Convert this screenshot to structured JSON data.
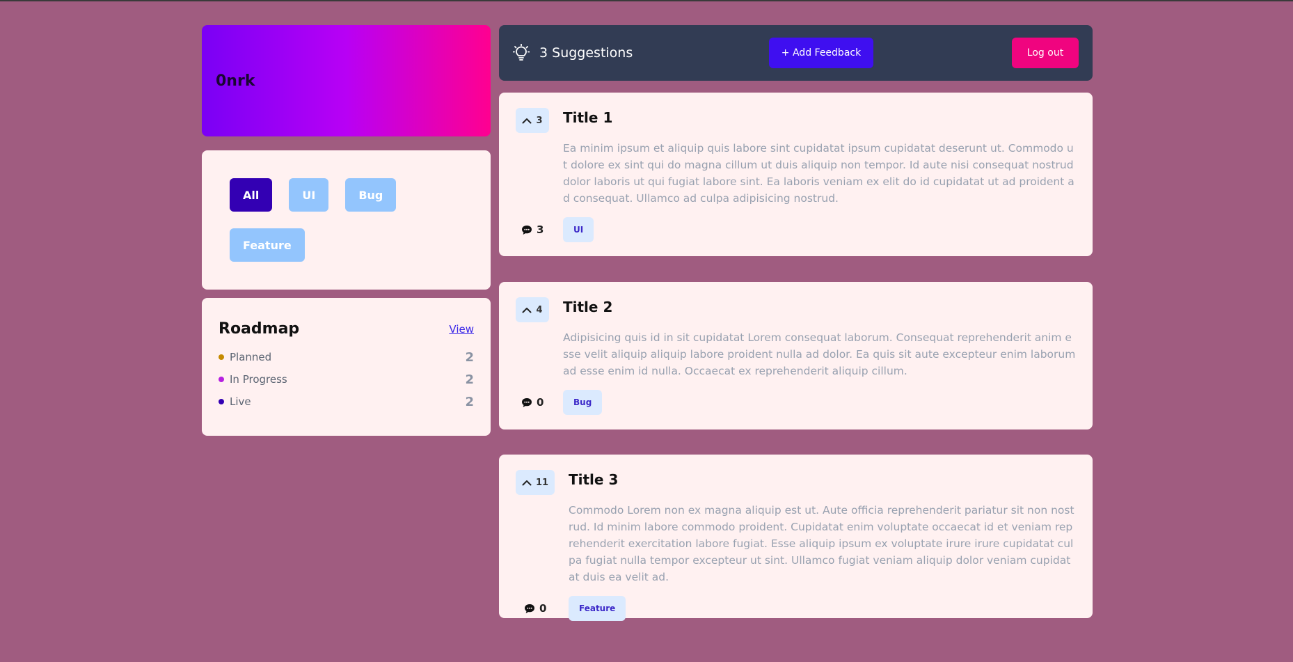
{
  "brand": {
    "name": "0nrk"
  },
  "filters": {
    "chips": [
      {
        "label": "All",
        "active": true
      },
      {
        "label": "UI",
        "active": false
      },
      {
        "label": "Bug",
        "active": false
      },
      {
        "label": "Feature",
        "active": false
      }
    ]
  },
  "roadmap": {
    "title": "Roadmap",
    "view_label": "View",
    "items": [
      {
        "label": "Planned",
        "count": "2",
        "color": "#c58a00"
      },
      {
        "label": "In Progress",
        "count": "2",
        "color": "#b620e0"
      },
      {
        "label": "Live",
        "count": "2",
        "color": "#3300b3"
      }
    ]
  },
  "topbar": {
    "suggestions_label": "3 Suggestions",
    "icon": "lightbulb-icon",
    "add_button_label": "+ Add Feedback",
    "logout_label": "Log out"
  },
  "feedback": [
    {
      "title": "Title 1",
      "upvotes": "3",
      "description": "Ea minim ipsum et aliquip quis labore sint cupidatat ipsum cupidatat deserunt ut. Commodo ut dolore ex sint qui do magna cillum ut duis aliquip non tempor. Id aute nisi consequat nostrud dolor laboris ut qui fugiat labore sint. Ea laboris veniam ex elit do id cupidatat ut ad proident ad consequat. Ullamco ad culpa adipisicing nostrud.",
      "comments": "3",
      "tag": "UI"
    },
    {
      "title": "Title 2",
      "upvotes": "4",
      "description": "Adipisicing quis id in sit cupidatat Lorem consequat laborum. Consequat reprehenderit anim esse velit aliquip aliquip labore proident nulla ad dolor. Ea quis sit aute excepteur enim laborum ad esse enim id nulla. Occaecat ex reprehenderit aliquip cillum.",
      "comments": "0",
      "tag": "Bug"
    },
    {
      "title": "Title 3",
      "upvotes": "11",
      "description": "Commodo Lorem non ex magna aliquip est ut. Aute officia reprehenderit pariatur sit non nostrud. Id minim labore commodo proident. Cupidatat enim voluptate occaecat id et veniam reprehenderit exercitation labore fugiat. Esse aliquip ipsum ex voluptate irure irure cupidatat culpa fugiat nulla tempor excepteur ut sint. Ullamco fugiat veniam aliquip dolor veniam cupidatat duis ea velit ad.",
      "comments": "0",
      "tag": "Feature"
    }
  ],
  "colors": {
    "background": "#a05c80",
    "card": "#fff1f1",
    "topbar": "#323c54",
    "accent": "#3f0ff0",
    "logout": "#f0047f",
    "chip_active": "#3300b3",
    "chip_inactive": "#93c5fd"
  }
}
